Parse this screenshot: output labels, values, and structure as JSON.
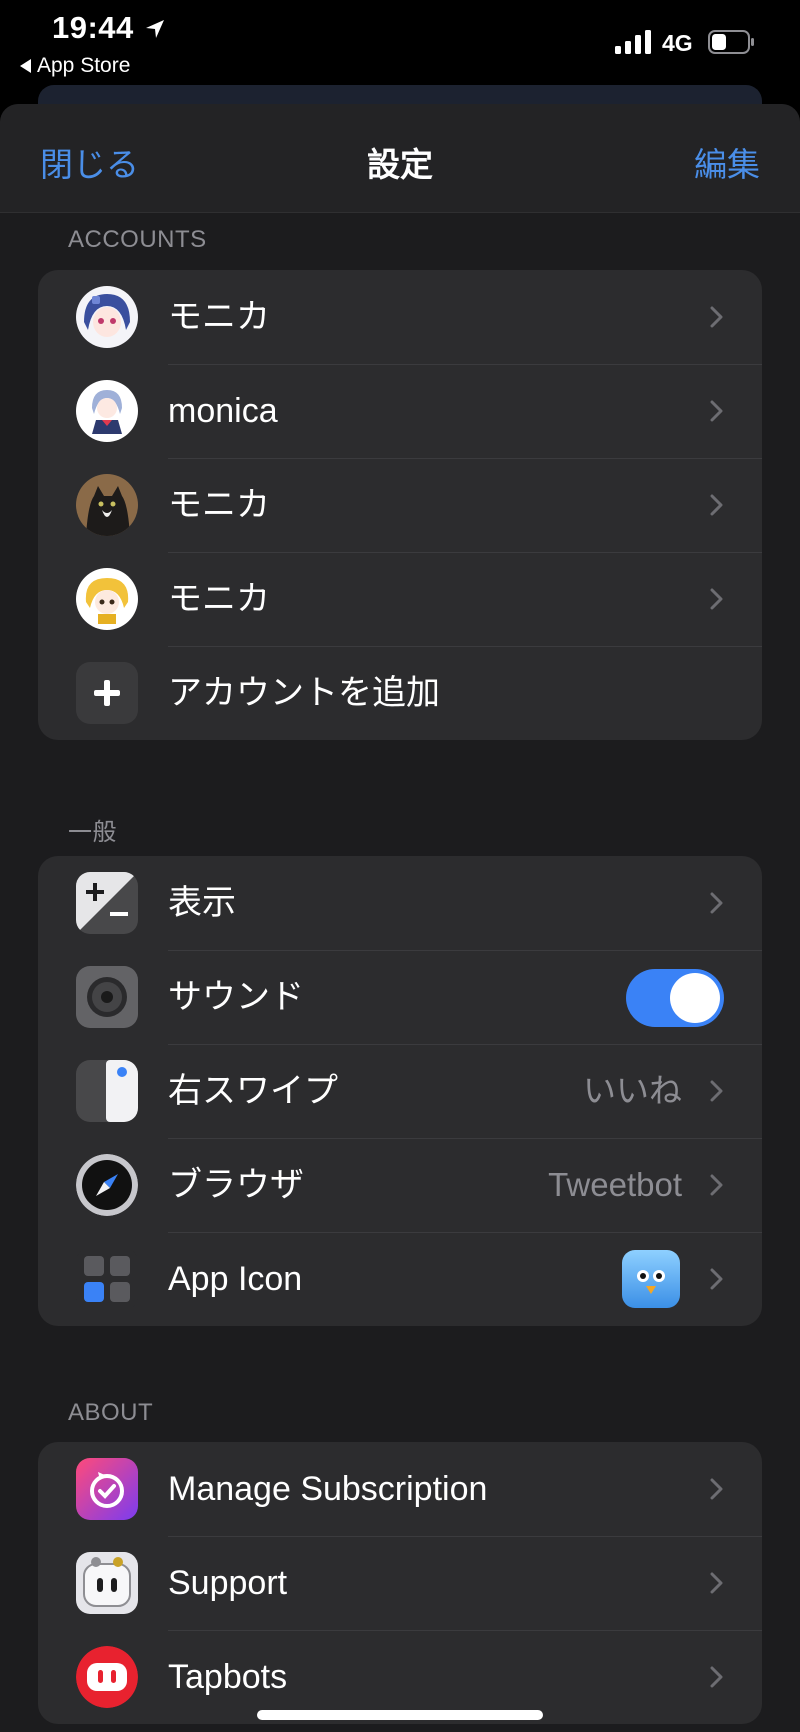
{
  "status": {
    "time": "19:44",
    "back_label": "App Store",
    "network": "4G"
  },
  "nav": {
    "close": "閉じる",
    "title": "設定",
    "edit": "編集"
  },
  "accounts": {
    "header": "ACCOUNTS",
    "items": [
      {
        "name": "モニカ",
        "avatar": "anime-blue-hair-avatar"
      },
      {
        "name": "monica",
        "avatar": "anime-sailor-avatar"
      },
      {
        "name": "モニカ",
        "avatar": "cat-photo-avatar"
      },
      {
        "name": "モニカ",
        "avatar": "anime-blonde-avatar"
      }
    ],
    "add_label": "アカウントを追加"
  },
  "general": {
    "header": "一般",
    "display": "表示",
    "sound": "サウンド",
    "sound_on": true,
    "swipe": "右スワイプ",
    "swipe_value": "いいね",
    "browser": "ブラウザ",
    "browser_value": "Tweetbot",
    "app_icon": "App Icon"
  },
  "about": {
    "header": "ABOUT",
    "manage": "Manage Subscription",
    "support": "Support",
    "tapbots": "Tapbots"
  },
  "colors": {
    "accent": "#4a8ee8",
    "toggle_on": "#3a82f6",
    "tapbots_red": "#e8222f"
  }
}
